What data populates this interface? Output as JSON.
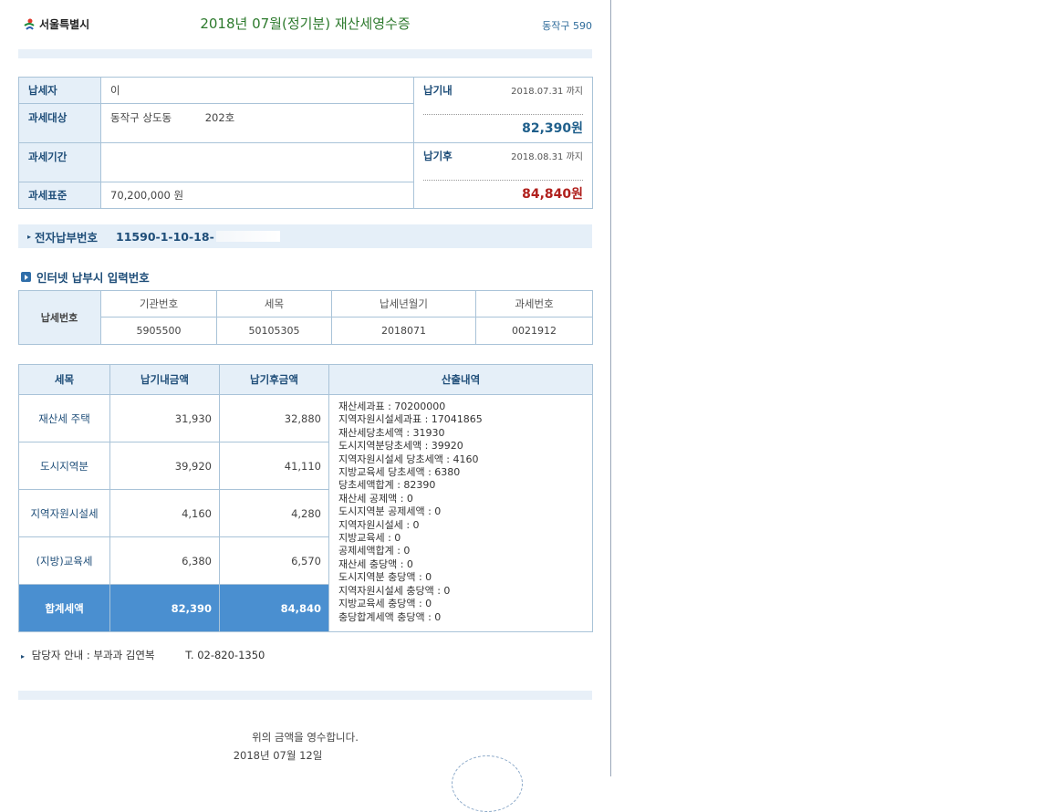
{
  "header": {
    "logo_text": "서울특별시",
    "title": "2018년 07월(정기분) 재산세영수증",
    "code": "동작구 590"
  },
  "info": {
    "payer_label": "납세자",
    "payer_value": "이",
    "target_label": "과세대상",
    "target_value": "동작구 상도동          202호",
    "period_label": "과세기간",
    "period_value": "",
    "standard_label": "과세표준",
    "standard_value": "70,200,000 원",
    "before": {
      "label": "납기내",
      "date": "2018.07.31 까지",
      "amount": "82,390원"
    },
    "after": {
      "label": "납기후",
      "date": "2018.08.31 까지",
      "amount": "84,840원"
    }
  },
  "electronic": {
    "label": "전자납부번호",
    "number": "11590-1-10-18-"
  },
  "internet": {
    "title": "인터넷 납부시 입력번호",
    "row_label": "납세번호",
    "headers": [
      "기관번호",
      "세목",
      "납세년월기",
      "과세번호"
    ],
    "values": [
      "5905500",
      "50105305",
      "2018071",
      "0021912"
    ]
  },
  "tax_table": {
    "headers": [
      "세목",
      "납기내금액",
      "납기후금액",
      "산출내역"
    ],
    "rows": [
      {
        "name": "재산세 주택",
        "before": "31,930",
        "after": "32,880"
      },
      {
        "name": "도시지역분",
        "before": "39,920",
        "after": "41,110"
      },
      {
        "name": "지역자원시설세",
        "before": "4,160",
        "after": "4,280"
      },
      {
        "name": "(지방)교육세",
        "before": "6,380",
        "after": "6,570"
      }
    ],
    "total": {
      "name": "합계세액",
      "before": "82,390",
      "after": "84,840"
    },
    "details": [
      "재산세과표 : 70200000",
      "지역자원시설세과표 : 17041865",
      "재산세당초세액 : 31930",
      "도시지역분당초세액 : 39920",
      "지역자원시설세 당초세액 : 4160",
      "지방교육세 당초세액 : 6380",
      "당초세액합계 : 82390",
      "재산세 공제액 : 0",
      "도시지역분 공제세액 : 0",
      "지역자원시설세 : 0",
      "지방교육세 : 0",
      "공제세액합계 : 0",
      "재산세 충당액 : 0",
      "도시지역분 충당액 : 0",
      "지역자원시설세 충당액 : 0",
      "지방교육세 충당액 : 0",
      "충당합계세액 충당액 : 0"
    ]
  },
  "contact": {
    "text": "담당자 안내 : 부과과 김연복",
    "phone": "T. 02-820-1350"
  },
  "receipt": {
    "line1": "위의 금액을 영수합니다.",
    "line2": "2018년 07월 12일"
  }
}
